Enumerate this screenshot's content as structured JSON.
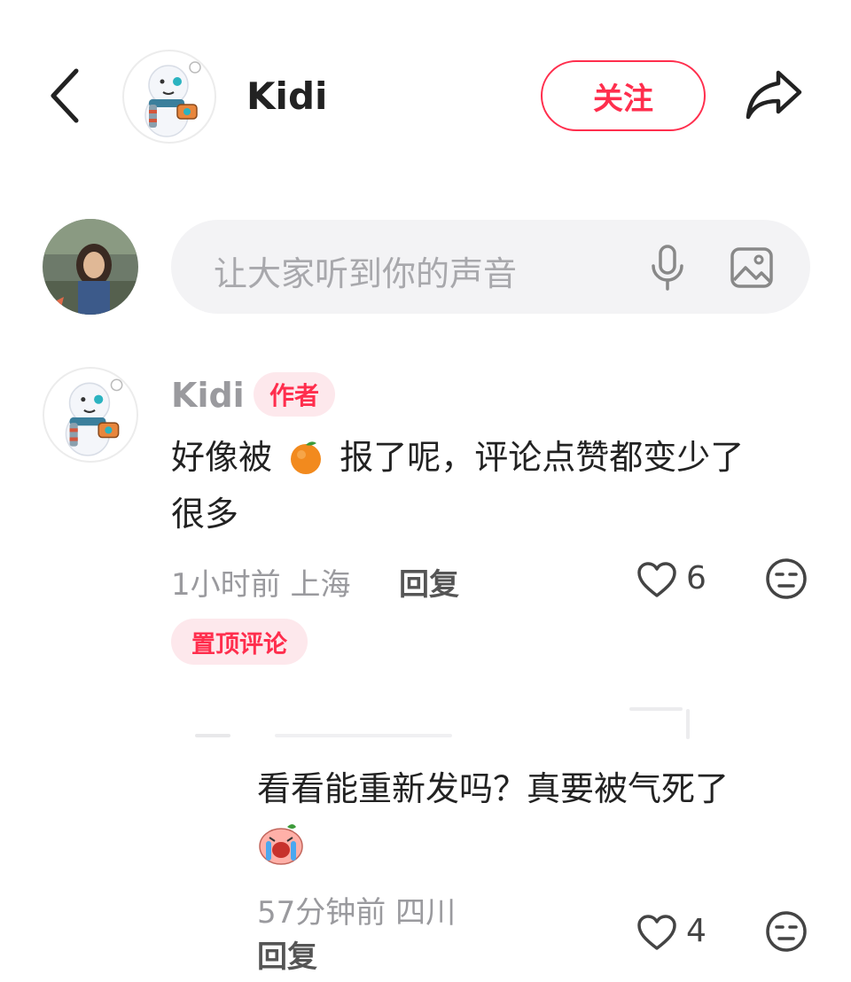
{
  "header": {
    "back_icon": "chevron-left-icon",
    "username": "Kidi",
    "follow_label": "关注",
    "share_icon": "share-arrow-icon"
  },
  "composer": {
    "placeholder": "让大家听到你的声音",
    "mic_icon": "microphone-icon",
    "image_icon": "image-icon"
  },
  "comments": [
    {
      "username": "Kidi",
      "badge": "作者",
      "text_part1": "好像被",
      "text_part2": "报了呢，评论点赞都变少了",
      "text_line2": "很多",
      "time": "1小时前 上海",
      "reply_label": "回复",
      "likes": "6",
      "pinned_label": "置顶评论"
    },
    {
      "text_line1": "看看能重新发吗？真要被气死了",
      "time": "57分钟前 四川",
      "reply_label": "回复",
      "likes": "4"
    }
  ],
  "colors": {
    "accent": "#ff2e4d",
    "badge_bg": "#fde8ec",
    "input_bg": "#f3f3f5",
    "meta_text": "#9a9a9e"
  }
}
